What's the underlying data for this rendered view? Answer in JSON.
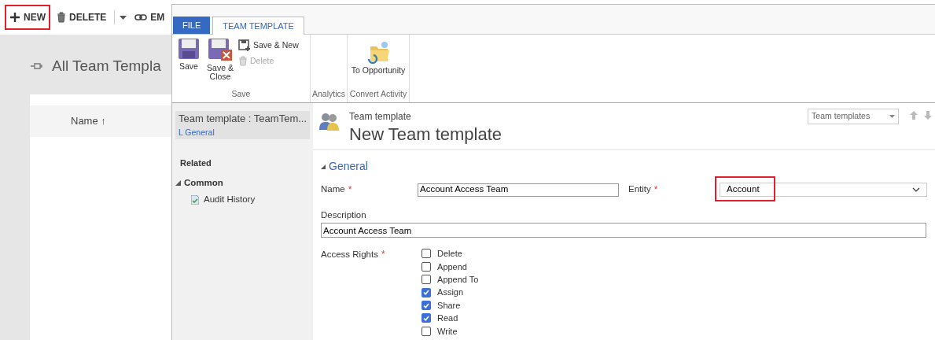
{
  "background_page": {
    "toolbar": [
      {
        "kind": "plus",
        "label": "NEW",
        "highlighted": true
      },
      {
        "kind": "trash",
        "label": "DELETE",
        "highlighted": false
      },
      {
        "kind": "caret"
      },
      {
        "kind": "link",
        "label": "EM",
        "highlighted": false
      }
    ],
    "title": "All Team Templa",
    "column_header": "Name ↑"
  },
  "window": {
    "tabs": [
      {
        "label": "FILE",
        "selected": false,
        "kind": "file"
      },
      {
        "label": "TEAM TEMPLATE",
        "selected": true,
        "kind": "tab"
      }
    ],
    "ribbon_groups": [
      {
        "label": "Save",
        "items": [
          {
            "kind": "save",
            "label": "Save",
            "disabled": false
          },
          {
            "kind": "save-close",
            "label": "Save & Close",
            "disabled": false
          },
          {
            "kind": "save-new",
            "label": "Save & New",
            "disabled": false
          },
          {
            "kind": "delete",
            "label": "Delete",
            "disabled": true
          }
        ]
      },
      {
        "label": "Analytics"
      },
      {
        "label": "Convert Activity",
        "items": [
          {
            "kind": "folder",
            "label": "To Opportunity",
            "disabled": false
          }
        ]
      }
    ],
    "nav": {
      "record_title": "Team template : TeamTem...",
      "section_link": "L General",
      "related_heading": "Related",
      "groups": [
        {
          "label": "Common",
          "expanded": true,
          "children": [
            {
              "label": "Audit History"
            }
          ]
        }
      ]
    },
    "header": {
      "entity_label": "Team template",
      "record_name": "New Team template",
      "view_selector": "Team templates"
    },
    "section": {
      "label": "General",
      "expanded": true
    },
    "fields": {
      "name": {
        "label": "Name",
        "required_mark": "*",
        "value": "Account Access Team"
      },
      "entity": {
        "label": "Entity",
        "required_mark": "*",
        "value": "Account",
        "highlighted": true
      },
      "description": {
        "label": "Description",
        "value": "Account Access Team"
      },
      "access_rights": {
        "label": "Access Rights",
        "required_mark": "*",
        "options": [
          {
            "label": "Delete",
            "checked": false
          },
          {
            "label": "Append",
            "checked": false
          },
          {
            "label": "Append To",
            "checked": false
          },
          {
            "label": "Assign",
            "checked": true
          },
          {
            "label": "Share",
            "checked": true
          },
          {
            "label": "Read",
            "checked": true
          },
          {
            "label": "Write",
            "checked": false
          }
        ]
      }
    }
  }
}
